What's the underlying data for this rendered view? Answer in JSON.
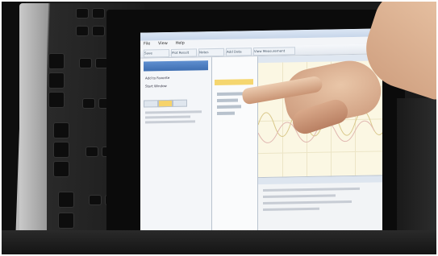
{
  "screen": {
    "menu_items": [
      "File",
      "View",
      "Help"
    ],
    "toolbar_buttons": [
      "Save",
      "Plot Result",
      "Notes",
      "Add Data",
      "View Measurement"
    ],
    "left_pane": {
      "items": [
        "Add to Favorite",
        "Start Window"
      ]
    }
  }
}
